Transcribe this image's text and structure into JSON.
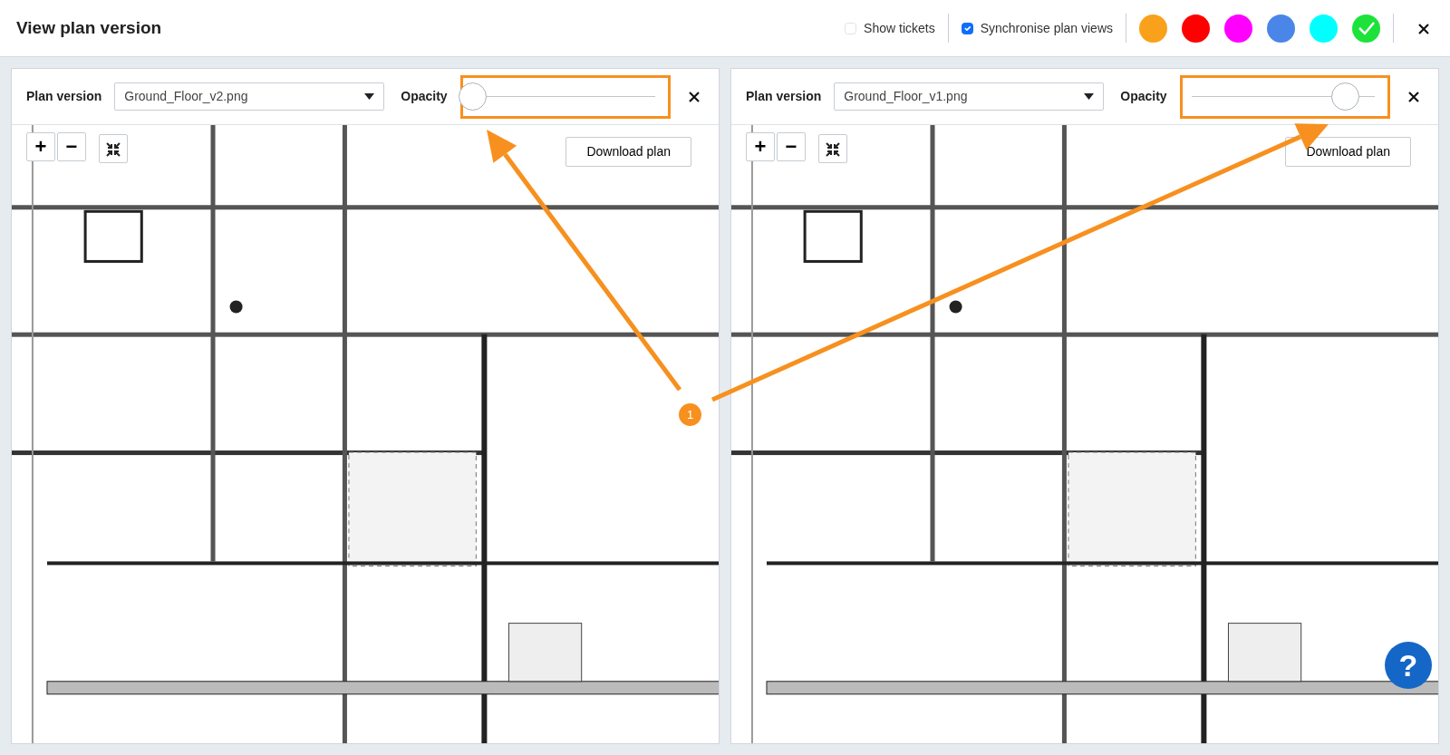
{
  "window": {
    "title": "View plan version"
  },
  "toolbar": {
    "show_tickets": {
      "label": "Show tickets",
      "checked": false
    },
    "synchronise": {
      "label": "Synchronise plan views",
      "checked": true
    },
    "colors": [
      {
        "color": "#f9a11b",
        "selected": false
      },
      {
        "color": "#ff0000",
        "selected": false
      },
      {
        "color": "#ff00ff",
        "selected": false
      },
      {
        "color": "#4a86e8",
        "selected": false
      },
      {
        "color": "#00ffff",
        "selected": false
      },
      {
        "color": "#1de23a",
        "selected": true
      }
    ]
  },
  "panels": [
    {
      "label": "Plan version",
      "file": "Ground_Floor_v2.png",
      "opacity_label": "Opacity",
      "opacity": {
        "level": 0
      },
      "highlighted": true,
      "zoom_in": "+",
      "zoom_out": "−",
      "download": "Download plan"
    },
    {
      "label": "Plan version",
      "file": "Ground_Floor_v1.png",
      "opacity_label": "Opacity",
      "opacity": {
        "level": 0.84
      },
      "highlighted": true,
      "zoom_in": "+",
      "zoom_out": "−",
      "download": "Download plan"
    }
  ],
  "annotation": {
    "callout": "1"
  },
  "help": "?"
}
